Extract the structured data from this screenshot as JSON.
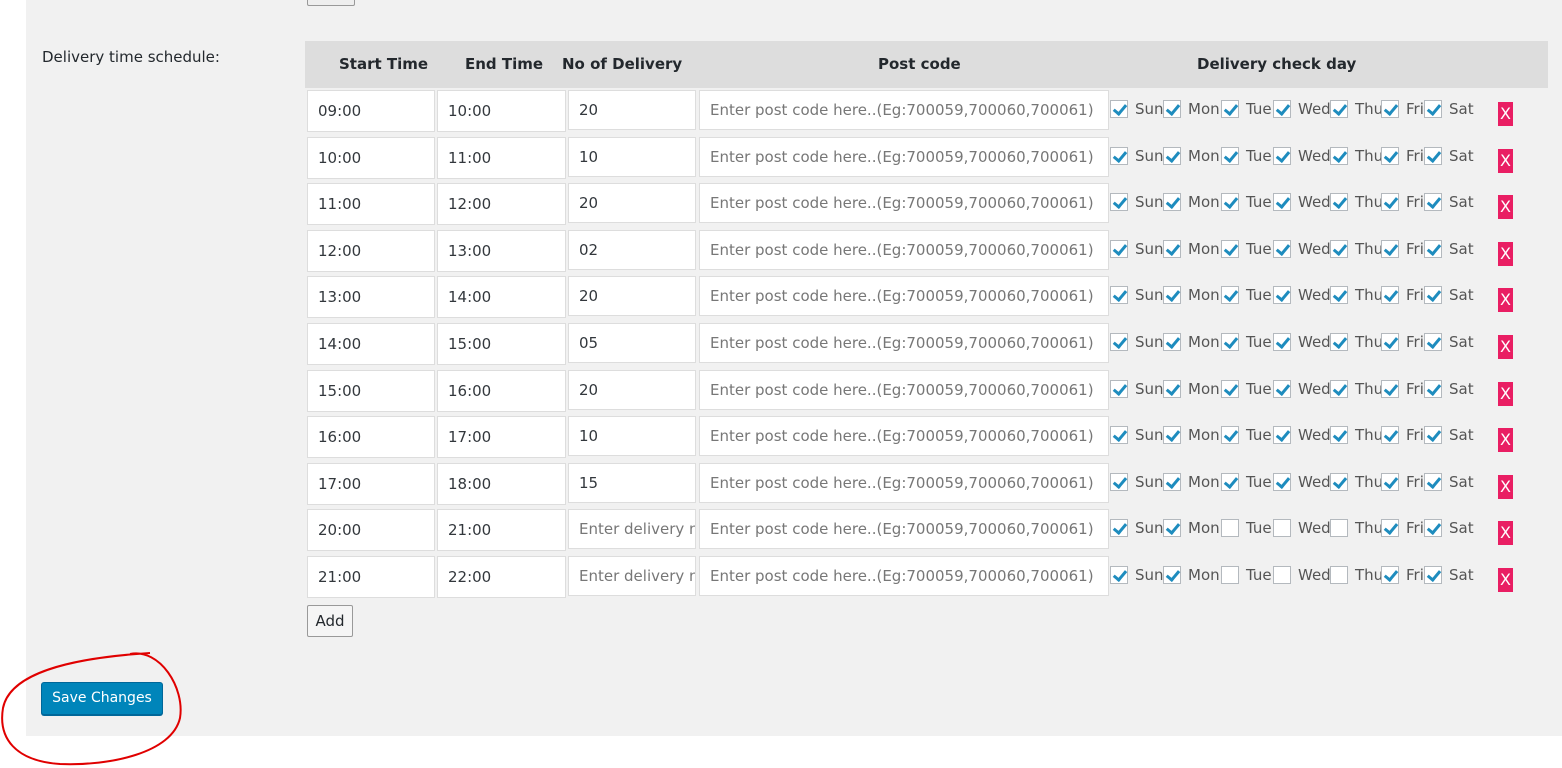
{
  "section_label": "Delivery time schedule:",
  "headers": {
    "start": "Start Time",
    "end": "End Time",
    "count": "No of Delivery",
    "postcode": "Post code",
    "days": "Delivery check day"
  },
  "day_labels": [
    "Sun",
    "Mon",
    "Tue",
    "Wed",
    "Thu",
    "Fri",
    "Sat"
  ],
  "postcode_placeholder": "Enter post code here..(Eg:700059,700060,700061)",
  "count_placeholder": "Enter delivery no",
  "delete_label": "X",
  "rows": [
    {
      "start": "09:00",
      "end": "10:00",
      "count": "20",
      "days": [
        true,
        true,
        true,
        true,
        true,
        true,
        true
      ]
    },
    {
      "start": "10:00",
      "end": "11:00",
      "count": "10",
      "days": [
        true,
        true,
        true,
        true,
        true,
        true,
        true
      ]
    },
    {
      "start": "11:00",
      "end": "12:00",
      "count": "20",
      "days": [
        true,
        true,
        true,
        true,
        true,
        true,
        true
      ]
    },
    {
      "start": "12:00",
      "end": "13:00",
      "count": "02",
      "days": [
        true,
        true,
        true,
        true,
        true,
        true,
        true
      ]
    },
    {
      "start": "13:00",
      "end": "14:00",
      "count": "20",
      "days": [
        true,
        true,
        true,
        true,
        true,
        true,
        true
      ]
    },
    {
      "start": "14:00",
      "end": "15:00",
      "count": "05",
      "days": [
        true,
        true,
        true,
        true,
        true,
        true,
        true
      ]
    },
    {
      "start": "15:00",
      "end": "16:00",
      "count": "20",
      "days": [
        true,
        true,
        true,
        true,
        true,
        true,
        true
      ]
    },
    {
      "start": "16:00",
      "end": "17:00",
      "count": "10",
      "days": [
        true,
        true,
        true,
        true,
        true,
        true,
        true
      ]
    },
    {
      "start": "17:00",
      "end": "18:00",
      "count": "15",
      "days": [
        true,
        true,
        true,
        true,
        true,
        true,
        true
      ]
    },
    {
      "start": "20:00",
      "end": "21:00",
      "count": "",
      "days": [
        true,
        true,
        false,
        false,
        false,
        true,
        true
      ]
    },
    {
      "start": "21:00",
      "end": "22:00",
      "count": "",
      "days": [
        true,
        true,
        false,
        false,
        false,
        true,
        true
      ]
    }
  ],
  "add_label": "Add",
  "save_label": "Save Changes",
  "colors": {
    "save": "#0085ba",
    "delete": "#e91e63",
    "check": "#1e8cbe",
    "annotation": "#e00000"
  }
}
